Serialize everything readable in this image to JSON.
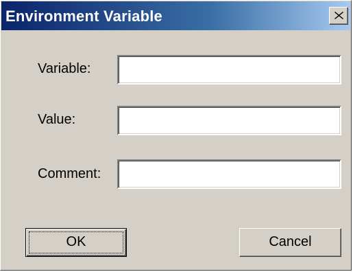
{
  "dialog": {
    "title": "Environment Variable",
    "close_icon": "close-x-icon"
  },
  "fields": [
    {
      "label": "Variable:",
      "value": ""
    },
    {
      "label": "Value:",
      "value": ""
    },
    {
      "label": "Comment:",
      "value": ""
    }
  ],
  "buttons": {
    "ok_label": "OK",
    "cancel_label": "Cancel"
  },
  "colors": {
    "title_gradient_start": "#0a246a",
    "title_gradient_end": "#a6caf0",
    "face": "#d4d0c8"
  }
}
